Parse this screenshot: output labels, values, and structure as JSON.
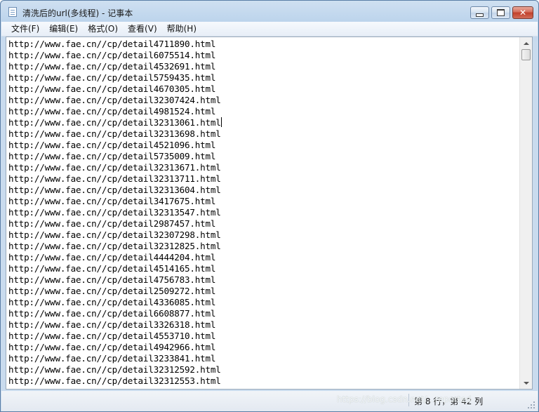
{
  "window": {
    "title": "清洗后的url(多线程) - 记事本"
  },
  "menu": [
    "文件(F)",
    "编辑(E)",
    "格式(O)",
    "查看(V)",
    "帮助(H)"
  ],
  "editor": {
    "lines": [
      "http://www.fae.cn//cp/detail4711890.html",
      "http://www.fae.cn//cp/detail6075514.html",
      "http://www.fae.cn//cp/detail4532691.html",
      "http://www.fae.cn//cp/detail5759435.html",
      "http://www.fae.cn//cp/detail4670305.html",
      "http://www.fae.cn//cp/detail32307424.html",
      "http://www.fae.cn//cp/detail4981524.html",
      "http://www.fae.cn//cp/detail32313061.html",
      "http://www.fae.cn//cp/detail32313698.html",
      "http://www.fae.cn//cp/detail4521096.html",
      "http://www.fae.cn//cp/detail5735009.html",
      "http://www.fae.cn//cp/detail32313671.html",
      "http://www.fae.cn//cp/detail32313711.html",
      "http://www.fae.cn//cp/detail32313604.html",
      "http://www.fae.cn//cp/detail3417675.html",
      "http://www.fae.cn//cp/detail32313547.html",
      "http://www.fae.cn//cp/detail2987457.html",
      "http://www.fae.cn//cp/detail32307298.html",
      "http://www.fae.cn//cp/detail32312825.html",
      "http://www.fae.cn//cp/detail4444204.html",
      "http://www.fae.cn//cp/detail4514165.html",
      "http://www.fae.cn//cp/detail4756783.html",
      "http://www.fae.cn//cp/detail2509272.html",
      "http://www.fae.cn//cp/detail4336085.html",
      "http://www.fae.cn//cp/detail6608877.html",
      "http://www.fae.cn//cp/detail3326318.html",
      "http://www.fae.cn//cp/detail4553710.html",
      "http://www.fae.cn//cp/detail4942966.html",
      "http://www.fae.cn//cp/detail3233841.html",
      "http://www.fae.cn//cp/detail32312592.html",
      "http://www.fae.cn//cp/detail32312553.html"
    ],
    "caret_line": 8
  },
  "status": {
    "position": "第 8 行，第 42 列"
  },
  "watermark": "https://blog.csdn.net/...reported"
}
